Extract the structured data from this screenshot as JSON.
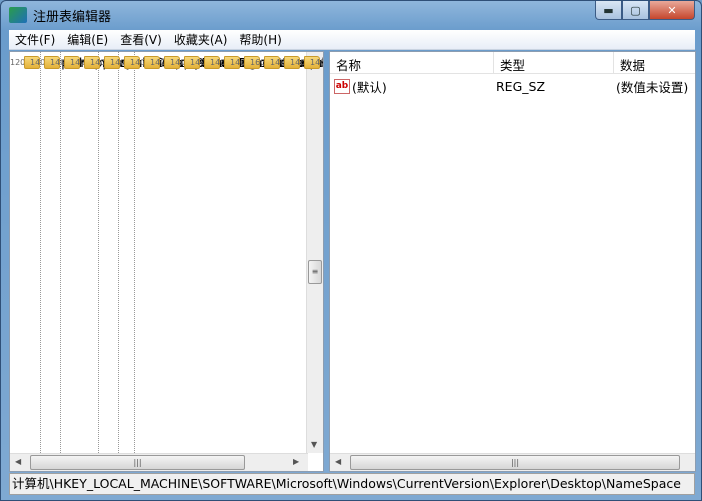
{
  "window": {
    "title": "注册表编辑器",
    "minimize": "▬",
    "maximize": "▢",
    "close": "✕"
  },
  "menu": [
    "文件(F)",
    "编辑(E)",
    "查看(V)",
    "收藏夹(A)",
    "帮助(H)"
  ],
  "tree": {
    "parent": "Explorer",
    "items": [
      {
        "label": "Advanced",
        "expander": "▷"
      },
      {
        "label": "AppKey",
        "expander": "▷"
      },
      {
        "label": "Associations",
        "expander": ""
      },
      {
        "label": "AutoComplete",
        "expander": "▷"
      },
      {
        "label": "AutoplayHandlers",
        "expander": "▷"
      },
      {
        "label": "BrowseNewProcess",
        "expander": ""
      },
      {
        "label": "CD Burning",
        "expander": "▷"
      },
      {
        "label": "CommandStore",
        "expander": "▷"
      },
      {
        "label": "CommonPlaces",
        "expander": "▷"
      },
      {
        "label": "ControlPanel",
        "expander": "▷"
      },
      {
        "label": "Desktop",
        "expander": "◢"
      },
      {
        "label": "NameSpace",
        "expander": "▷",
        "child": true,
        "selected": true
      },
      {
        "label": "DesktopIniPropertyM",
        "expander": "▷"
      },
      {
        "label": "DeviceUpdateLocatic",
        "expander": "▷"
      },
      {
        "label": "FileAssociation",
        "expander": "▷"
      },
      {
        "label": "FindExtensions",
        "expander": "▷"
      },
      {
        "label": "FolderDescriptions",
        "expander": "▷"
      },
      {
        "label": "FolderTypes",
        "expander": "▷"
      },
      {
        "label": "FontsFolder",
        "expander": "▷"
      }
    ]
  },
  "values": {
    "columns": [
      "名称",
      "类型",
      "数据"
    ],
    "rows": [
      {
        "icon": "ab",
        "name": "(默认)",
        "type": "REG_SZ",
        "data": "(数值未设置)"
      }
    ]
  },
  "status": "计算机\\HKEY_LOCAL_MACHINE\\SOFTWARE\\Microsoft\\Windows\\CurrentVersion\\Explorer\\Desktop\\NameSpace"
}
